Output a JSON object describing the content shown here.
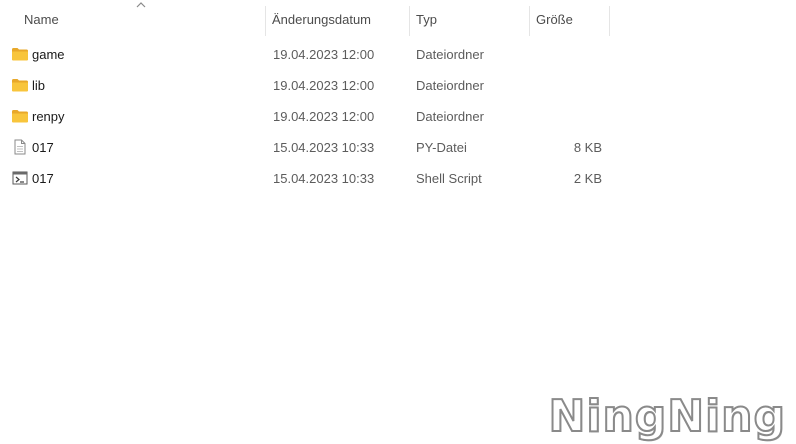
{
  "columns": {
    "name": "Name",
    "date": "Änderungsdatum",
    "type": "Typ",
    "size": "Größe",
    "sorted_by": "Name",
    "sort_direction": "ascending"
  },
  "files": [
    {
      "name": "game",
      "date": "19.04.2023 12:00",
      "type": "Dateiordner",
      "size": "",
      "icon": "folder-icon"
    },
    {
      "name": "lib",
      "date": "19.04.2023 12:00",
      "type": "Dateiordner",
      "size": "",
      "icon": "folder-icon"
    },
    {
      "name": "renpy",
      "date": "19.04.2023 12:00",
      "type": "Dateiordner",
      "size": "",
      "icon": "folder-icon"
    },
    {
      "name": "017",
      "date": "15.04.2023 10:33",
      "type": "PY-Datei",
      "size": "8 KB",
      "icon": "document-icon"
    },
    {
      "name": "017",
      "date": "15.04.2023 10:33",
      "type": "Shell Script",
      "size": "2 KB",
      "icon": "script-icon"
    }
  ],
  "watermark": "NingNing",
  "colors": {
    "folder": "#f8c53c",
    "header_text": "#4c4c4c",
    "secondary_text": "#5c5c5c"
  }
}
